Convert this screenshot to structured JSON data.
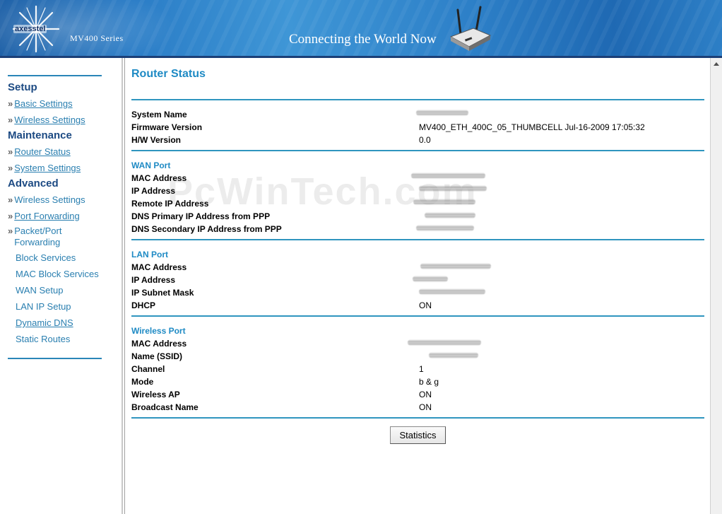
{
  "header": {
    "brand": "axesstel",
    "series": "MV400 Series",
    "tagline": "Connecting the World Now"
  },
  "sidebar": {
    "sections": [
      {
        "heading": "Setup",
        "items": [
          {
            "label": "Basic Settings"
          },
          {
            "label": "Wireless Settings"
          }
        ]
      },
      {
        "heading": "Maintenance",
        "items": [
          {
            "label": "Router Status"
          },
          {
            "label": "System Settings"
          }
        ]
      },
      {
        "heading": "Advanced",
        "items": [
          {
            "label": "Wireless Settings"
          },
          {
            "label": "Port Forwarding"
          },
          {
            "label": "Packet/Port Forwarding"
          },
          {
            "label": "Block Services"
          },
          {
            "label": "MAC Block Services"
          },
          {
            "label": "WAN Setup"
          },
          {
            "label": "LAN IP Setup"
          },
          {
            "label": "Dynamic DNS"
          },
          {
            "label": "Static Routes"
          }
        ]
      }
    ],
    "bullet": "»"
  },
  "main": {
    "title": "Router Status",
    "watermark": "PcWinTech.com",
    "system": {
      "rows": [
        {
          "label": "System Name",
          "value": ""
        },
        {
          "label": "Firmware Version",
          "value": "MV400_ETH_400C_05_THUMBCELL Jul-16-2009 17:05:32"
        },
        {
          "label": "H/W Version",
          "value": "0.0"
        }
      ]
    },
    "wan": {
      "title": "WAN Port",
      "rows": [
        {
          "label": "MAC Address",
          "value": ""
        },
        {
          "label": "IP Address",
          "value": ""
        },
        {
          "label": "Remote IP Address",
          "value": ""
        },
        {
          "label": "DNS Primary IP Address from PPP",
          "value": ""
        },
        {
          "label": "DNS Secondary IP Address from PPP",
          "value": ""
        }
      ]
    },
    "lan": {
      "title": "LAN Port",
      "rows": [
        {
          "label": "MAC Address",
          "value": ""
        },
        {
          "label": "IP Address",
          "value": ""
        },
        {
          "label": "IP Subnet Mask",
          "value": ""
        },
        {
          "label": "DHCP",
          "value": "ON"
        }
      ]
    },
    "wireless": {
      "title": "Wireless Port",
      "rows": [
        {
          "label": "MAC Address",
          "value": ""
        },
        {
          "label": "Name (SSID)",
          "value": ""
        },
        {
          "label": "Channel",
          "value": "1"
        },
        {
          "label": "Mode",
          "value": "b & g"
        },
        {
          "label": "Wireless AP",
          "value": "ON"
        },
        {
          "label": "Broadcast Name",
          "value": "ON"
        }
      ]
    },
    "statistics_button": "Statistics"
  },
  "colors": {
    "accent": "#1e8ac4",
    "heading": "#1c4a83",
    "link": "#2a7fb0"
  }
}
